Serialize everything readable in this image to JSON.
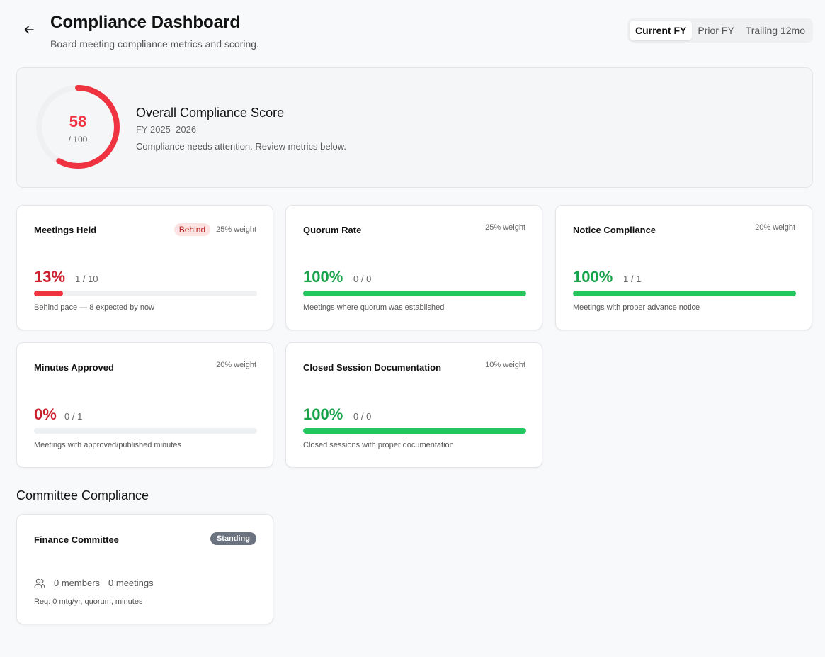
{
  "header": {
    "title": "Compliance Dashboard",
    "subtitle": "Board meeting compliance metrics and scoring.",
    "period_options": [
      "Current FY",
      "Prior FY",
      "Trailing 12mo"
    ],
    "selected_period": "Current FY"
  },
  "overall": {
    "score": "58",
    "denominator": "/ 100",
    "score_fraction": 0.58,
    "title": "Overall Compliance Score",
    "fiscal_year": "FY 2025–2026",
    "message": "Compliance needs attention. Review metrics below.",
    "color": "#ef3340"
  },
  "metrics": [
    {
      "name": "Meetings Held",
      "badge": "Behind",
      "weight": "25% weight",
      "percent": "13%",
      "count": "1 / 10",
      "fill": 0.13,
      "color": "#cc1f2f",
      "bar_color": "#ef3340",
      "description": "Behind pace — 8 expected by now"
    },
    {
      "name": "Quorum Rate",
      "badge": "",
      "weight": "25% weight",
      "percent": "100%",
      "count": "0 / 0",
      "fill": 1.0,
      "color": "#16a34a",
      "bar_color": "#22c55e",
      "description": "Meetings where quorum was established"
    },
    {
      "name": "Notice Compliance",
      "badge": "",
      "weight": "20% weight",
      "percent": "100%",
      "count": "1 / 1",
      "fill": 1.0,
      "color": "#16a34a",
      "bar_color": "#22c55e",
      "description": "Meetings with proper advance notice"
    },
    {
      "name": "Minutes Approved",
      "badge": "",
      "weight": "20% weight",
      "percent": "0%",
      "count": "0 / 1",
      "fill": 0.0,
      "color": "#cc1f2f",
      "bar_color": "#ef3340",
      "description": "Meetings with approved/published minutes"
    },
    {
      "name": "Closed Session Documentation",
      "badge": "",
      "weight": "10% weight",
      "percent": "100%",
      "count": "0 / 0",
      "fill": 1.0,
      "color": "#16a34a",
      "bar_color": "#22c55e",
      "description": "Closed sessions with proper documentation"
    }
  ],
  "committees_section": {
    "title": "Committee Compliance",
    "items": [
      {
        "name": "Finance Committee",
        "type": "Standing",
        "members": "0 members",
        "meetings": "0 meetings",
        "requirements": "Req: 0 mtg/yr, quorum, minutes",
        "icon": "users-icon"
      }
    ]
  },
  "icons": {
    "back": "arrow-left-icon",
    "members": "users-icon"
  }
}
